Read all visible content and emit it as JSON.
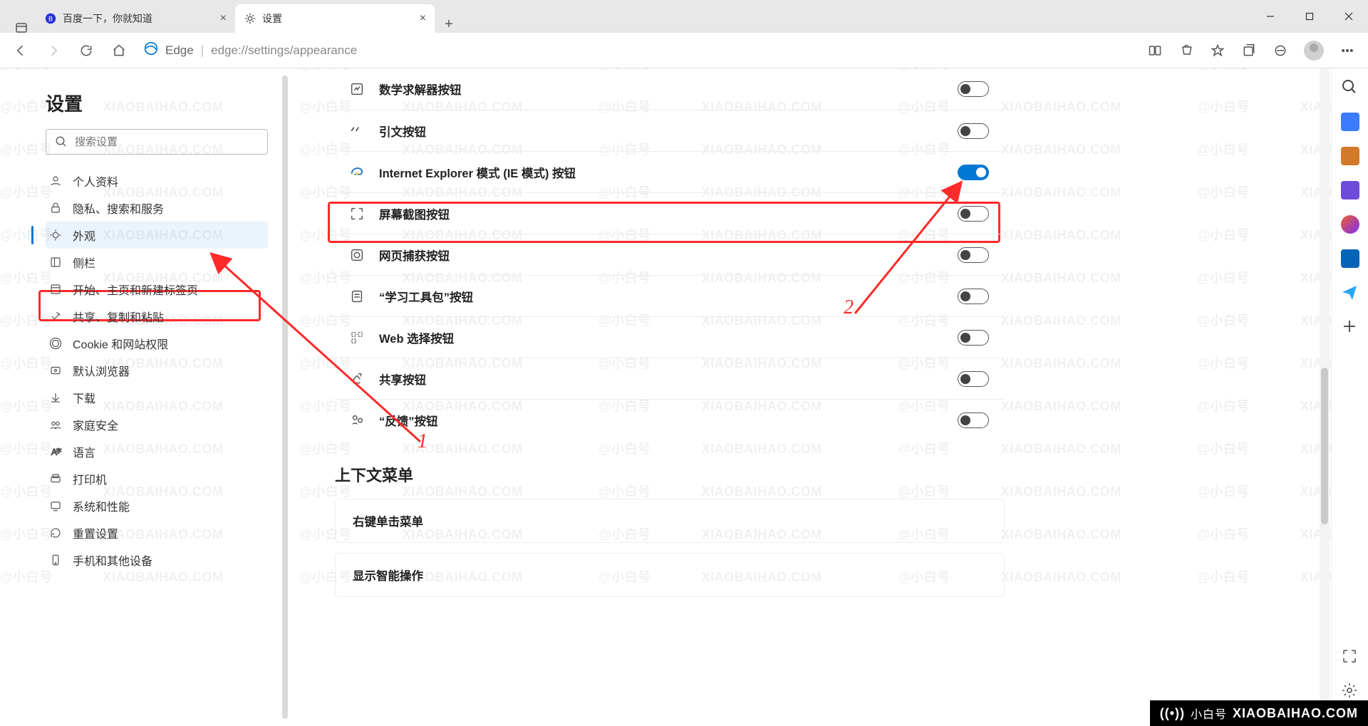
{
  "window": {
    "tabs": [
      {
        "title": "百度一下，你就知道"
      },
      {
        "title": "设置"
      }
    ]
  },
  "toolbar": {
    "app_label": "Edge",
    "url": "edge://settings/appearance"
  },
  "sidebar": {
    "heading": "设置",
    "search_placeholder": "搜索设置",
    "items": [
      "个人资料",
      "隐私、搜索和服务",
      "外观",
      "侧栏",
      "开始、主页和新建标签页",
      "共享、复制和粘贴",
      "Cookie 和网站权限",
      "默认浏览器",
      "下载",
      "家庭安全",
      "语言",
      "打印机",
      "系统和性能",
      "重置设置",
      "手机和其他设备"
    ],
    "active_index": 2
  },
  "settings_rows": [
    {
      "label": "数学求解器按钮",
      "on": false
    },
    {
      "label": "引文按钮",
      "on": false
    },
    {
      "label": "Internet Explorer 模式 (IE 模式) 按钮",
      "on": true
    },
    {
      "label": "屏幕截图按钮",
      "on": false
    },
    {
      "label": "网页捕获按钮",
      "on": false
    },
    {
      "label": "“学习工具包”按钮",
      "on": false
    },
    {
      "label": "Web 选择按钮",
      "on": false
    },
    {
      "label": "共享按钮",
      "on": false
    },
    {
      "label": "“反馈”按钮",
      "on": false
    }
  ],
  "context_menu_section": {
    "heading": "上下文菜单",
    "rows": [
      "右键单击菜单",
      "显示智能操作"
    ]
  },
  "annotations": {
    "label1": "1",
    "label2": "2"
  },
  "watermark_badge": {
    "cn": "小白号",
    "en": "XIAOBAIHAO.COM"
  }
}
